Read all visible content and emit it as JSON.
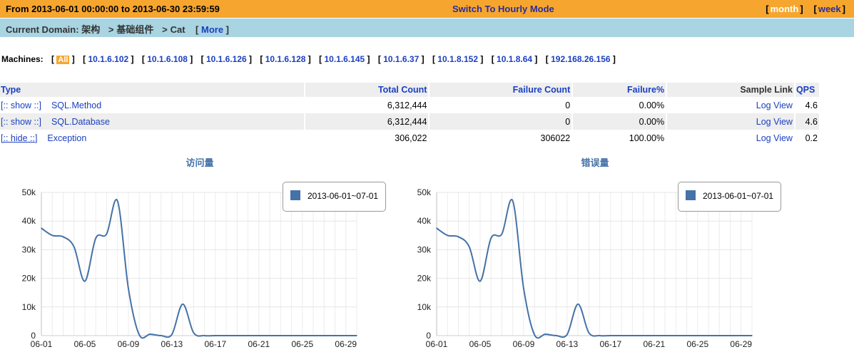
{
  "topbar": {
    "range": "From 2013-06-01 00:00:00 to 2013-06-30 23:59:59",
    "switch_label": "Switch To Hourly Mode",
    "month_label": "month",
    "week_label": "week"
  },
  "domain": {
    "label": "Current Domain:",
    "crumbs": [
      "架构",
      "基础组件",
      "Cat"
    ],
    "more_label": "More"
  },
  "machines": {
    "label": "Machines:",
    "selected": "All",
    "ips": [
      "10.1.6.102",
      "10.1.6.108",
      "10.1.6.126",
      "10.1.6.128",
      "10.1.6.145",
      "10.1.6.37",
      "10.1.8.152",
      "10.1.8.64",
      "192.168.26.156"
    ]
  },
  "table": {
    "headers": [
      "Type",
      "Total Count",
      "Failure Count",
      "Failure%",
      "Sample Link",
      "QPS"
    ],
    "rows": [
      {
        "toggle": "[:: show ::]",
        "type": "SQL.Method",
        "total": "6,312,444",
        "failure": "0",
        "pct": "0.00%",
        "link": "Log View",
        "qps": "4.6"
      },
      {
        "toggle": "[:: show ::]",
        "type": "SQL.Database",
        "total": "6,312,444",
        "failure": "0",
        "pct": "0.00%",
        "link": "Log View",
        "qps": "4.6"
      },
      {
        "toggle": "[:: hide ::]",
        "type": "Exception",
        "total": "306,022",
        "failure": "306022",
        "pct": "100.00%",
        "link": "Log View",
        "qps": "0.2"
      }
    ]
  },
  "chart_data": [
    {
      "type": "line",
      "title": "访问量",
      "x": [
        "06-01",
        "06-02",
        "06-03",
        "06-04",
        "06-05",
        "06-06",
        "06-07",
        "06-08",
        "06-09",
        "06-10",
        "06-11",
        "06-12",
        "06-13",
        "06-14",
        "06-15",
        "06-16",
        "06-17",
        "06-18",
        "06-19",
        "06-20",
        "06-21",
        "06-22",
        "06-23",
        "06-24",
        "06-25",
        "06-26",
        "06-27",
        "06-28",
        "06-29",
        "06-30"
      ],
      "x_ticks": [
        "06-01",
        "06-05",
        "06-09",
        "06-13",
        "06-17",
        "06-21",
        "06-25",
        "06-29"
      ],
      "y_ticks": [
        "0",
        "10k",
        "20k",
        "30k",
        "40k",
        "50k"
      ],
      "ylim": [
        0,
        50000
      ],
      "series": [
        {
          "name": "2013-06-01~07-01",
          "color": "#4572a7",
          "values": [
            37500,
            35000,
            34500,
            31000,
            19000,
            34000,
            35500,
            47000,
            16500,
            300,
            500,
            0,
            400,
            11000,
            1000,
            0,
            0,
            0,
            0,
            0,
            0,
            0,
            0,
            0,
            0,
            0,
            0,
            0,
            0,
            0
          ]
        }
      ]
    },
    {
      "type": "line",
      "title": "错误量",
      "x": [
        "06-01",
        "06-02",
        "06-03",
        "06-04",
        "06-05",
        "06-06",
        "06-07",
        "06-08",
        "06-09",
        "06-10",
        "06-11",
        "06-12",
        "06-13",
        "06-14",
        "06-15",
        "06-16",
        "06-17",
        "06-18",
        "06-19",
        "06-20",
        "06-21",
        "06-22",
        "06-23",
        "06-24",
        "06-25",
        "06-26",
        "06-27",
        "06-28",
        "06-29",
        "06-30"
      ],
      "x_ticks": [
        "06-01",
        "06-05",
        "06-09",
        "06-13",
        "06-17",
        "06-21",
        "06-25",
        "06-29"
      ],
      "y_ticks": [
        "0",
        "10k",
        "20k",
        "30k",
        "40k",
        "50k"
      ],
      "ylim": [
        0,
        50000
      ],
      "series": [
        {
          "name": "2013-06-01~07-01",
          "color": "#4572a7",
          "values": [
            37500,
            35000,
            34500,
            31000,
            19000,
            34000,
            35500,
            47000,
            16500,
            300,
            500,
            0,
            400,
            11000,
            1000,
            0,
            0,
            0,
            0,
            0,
            0,
            0,
            0,
            0,
            0,
            0,
            0,
            0,
            0,
            0
          ]
        }
      ]
    }
  ]
}
